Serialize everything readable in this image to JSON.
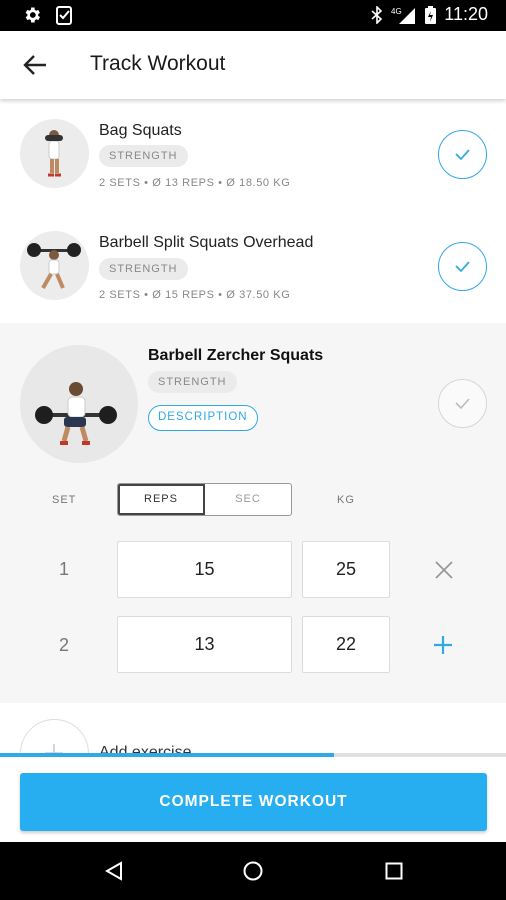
{
  "status_bar": {
    "time": "11:20",
    "network": "4G"
  },
  "app_bar": {
    "title": "Track Workout"
  },
  "exercises": [
    {
      "name": "Bag Squats",
      "tag": "STRENGTH",
      "meta": "2 SETS • Ø 13 REPS  • Ø 18.50 KG"
    },
    {
      "name": "Barbell Split Squats Overhead",
      "tag": "STRENGTH",
      "meta": "2 SETS • Ø 15 REPS  • Ø 37.50 KG"
    }
  ],
  "active": {
    "name": "Barbell Zercher Squats",
    "tag": "STRENGTH",
    "description_label": "DESCRIPTION",
    "headers": {
      "set": "SET",
      "reps": "REPS",
      "sec": "SEC",
      "kg": "KG"
    },
    "sets": [
      {
        "num": "1",
        "reps": "15",
        "kg": "25"
      },
      {
        "num": "2",
        "reps": "13",
        "kg": "22"
      }
    ]
  },
  "add_exercise_label": "Add exercise",
  "progress": 0.66,
  "complete_label": "COMPLETE WORKOUT",
  "accent_color": "#27aef0"
}
